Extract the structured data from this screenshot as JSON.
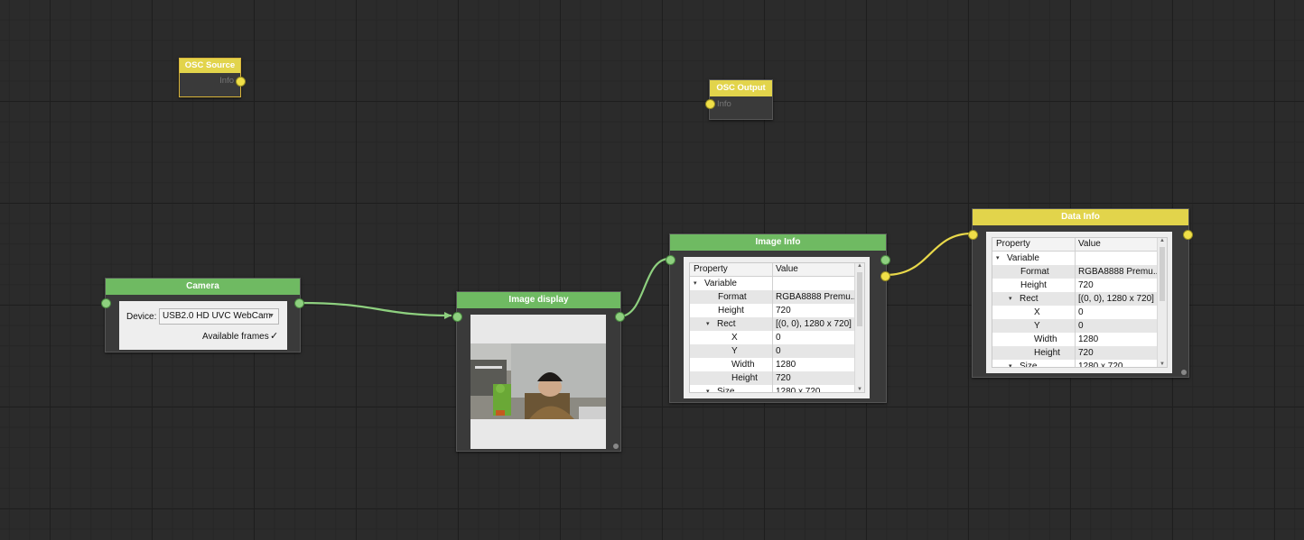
{
  "colors": {
    "green_node": "#6fba62",
    "yellow_node": "#e2d44b",
    "canvas_bg": "#2b2b2b",
    "green_edge": "#8ed07f",
    "yellow_edge": "#e8d84a"
  },
  "osc_source": {
    "title": "OSC Source",
    "out_port": "Info"
  },
  "osc_output": {
    "title": "OSC Output",
    "in_port": "Info"
  },
  "camera": {
    "title": "Camera",
    "device_label": "Device:",
    "device_value": "USB2.0 HD UVC WebCam",
    "available_frames_label": "Available frames",
    "available_frames_checked": true
  },
  "image_display": {
    "title": "Image display",
    "icon": "webcam-preview-image"
  },
  "image_info": {
    "title": "Image Info",
    "columns": [
      "Property",
      "Value"
    ],
    "rows": [
      {
        "key": "Variable",
        "value": "",
        "expander": "▾"
      },
      {
        "key": "Format",
        "value": "RGBA8888 Premu...",
        "expander": ""
      },
      {
        "key": "Height",
        "value": "720",
        "expander": ""
      },
      {
        "key": "Rect",
        "value": "[(0, 0), 1280 x 720]",
        "expander": "▾"
      },
      {
        "key": "X",
        "value": "0",
        "expander": ""
      },
      {
        "key": "Y",
        "value": "0",
        "expander": ""
      },
      {
        "key": "Width",
        "value": "1280",
        "expander": ""
      },
      {
        "key": "Height",
        "value": "720",
        "expander": ""
      },
      {
        "key": "Size",
        "value": "1280 x 720",
        "expander": "▾"
      }
    ]
  },
  "data_info": {
    "title": "Data Info",
    "columns": [
      "Property",
      "Value"
    ],
    "rows": [
      {
        "key": "Variable",
        "value": "",
        "expander": "▾"
      },
      {
        "key": "Format",
        "value": "RGBA8888 Premu...",
        "expander": ""
      },
      {
        "key": "Height",
        "value": "720",
        "expander": ""
      },
      {
        "key": "Rect",
        "value": "[(0, 0), 1280 x 720]",
        "expander": "▾"
      },
      {
        "key": "X",
        "value": "0",
        "expander": ""
      },
      {
        "key": "Y",
        "value": "0",
        "expander": ""
      },
      {
        "key": "Width",
        "value": "1280",
        "expander": ""
      },
      {
        "key": "Height",
        "value": "720",
        "expander": ""
      },
      {
        "key": "Size",
        "value": "1280 x 720",
        "expander": "▾"
      }
    ]
  }
}
